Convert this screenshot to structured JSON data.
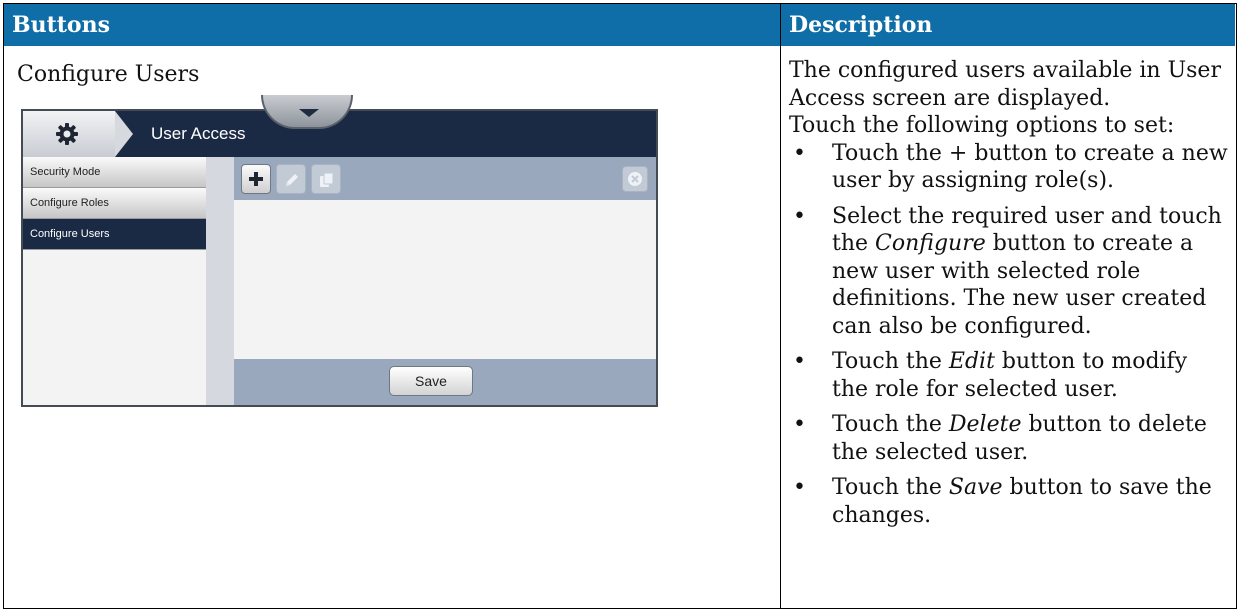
{
  "table": {
    "header_buttons": "Buttons",
    "header_description": "Description"
  },
  "row": {
    "title": "Configure Users",
    "screenshot": {
      "title": "User Access",
      "sidebar_items": [
        {
          "label": "Security Mode",
          "active": false
        },
        {
          "label": "Configure Roles",
          "active": false
        },
        {
          "label": "Configure Users",
          "active": true
        }
      ],
      "toolbar_icons": [
        "add-icon",
        "edit-icon",
        "copy-icon",
        "close-icon"
      ],
      "save_label": "Save",
      "colors": {
        "topbar": "#1b2a44",
        "toolbar": "#9aa8bd",
        "header_blue": "#0f6ea8"
      }
    },
    "description": {
      "intro": "The configured users available in User Access screen are displayed.",
      "touch_intro": "Touch the following options to set:",
      "bullet_symbol": "•",
      "bullets": {
        "b1": "Touch the + button to create a new user by assigning role(s).",
        "b2_pre": "Select the required user and touch the ",
        "b2_em": "Configure",
        "b2_post": " button to create a new user with selected role definitions. The new user created can also be configured.",
        "b3_pre": "Touch the ",
        "b3_em": "Edit",
        "b3_post": " button to modify the role for selected user.",
        "b4_pre": "Touch the ",
        "b4_em": "Delete",
        "b4_post": " button to delete the selected user.",
        "b5_pre": "Touch the ",
        "b5_em": "Save",
        "b5_post": " button to save the changes."
      }
    }
  }
}
